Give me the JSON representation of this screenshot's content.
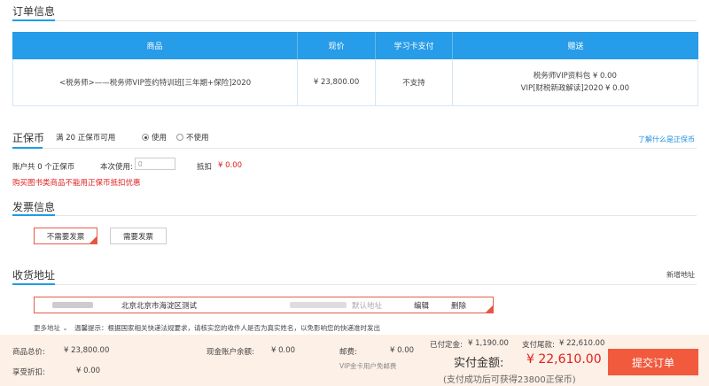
{
  "order": {
    "title": "订单信息",
    "headers": [
      "商品",
      "现价",
      "学习卡支付",
      "赠送"
    ],
    "item": {
      "name": "<税务师>——税务师VIP签约特训班[三年期+保险]2020",
      "price": "¥ 23,800.00",
      "card_pay": "不支持",
      "gifts": [
        "税务师VIP资料包 ¥ 0.00",
        "VIP[财税新政解读]2020 ¥ 0.00"
      ]
    }
  },
  "coin": {
    "title": "正保币",
    "available": "满 20 正保币可用",
    "use_label": "使用",
    "nouse_label": "不使用",
    "learn_more": "了解什么是正保币",
    "account": "账户共 0 个正保币",
    "use_now_label": "本次使用:",
    "use_now_value": "0",
    "deduct_label": "抵扣",
    "deduct_value": "¥ 0.00",
    "warning": "购买图书类商品不能用正保币抵扣优惠"
  },
  "invoice": {
    "title": "发票信息",
    "no_invoice": "不需要发票",
    "need_invoice": "需要发票"
  },
  "address": {
    "title": "收货地址",
    "add_new": "新增地址",
    "location": "北京北京市海淀区测试",
    "default_label": "默认地址",
    "edit": "编辑",
    "delete": "删除",
    "more": "更多地址",
    "tip": "温馨提示：根据国家相关快递法规要求，请核实您的收件人是否为真实姓名，以免影响您的快递准时发出"
  },
  "footer": {
    "total_label": "商品总价:",
    "total_value": "¥ 23,800.00",
    "discount_label": "享受折扣:",
    "discount_value": "¥ 0.00",
    "balance_label": "现金账户余额:",
    "balance_value": "¥ 0.00",
    "shipping_label": "邮费:",
    "shipping_value": "¥ 0.00",
    "vip_note": "VIP金卡用户免邮费",
    "deposit_label": "已付定金:",
    "deposit_value": "¥ 1,190.00",
    "balance_pay_label": "支付尾款:",
    "balance_pay_value": "¥ 22,610.00",
    "pay_label": "实付金额:",
    "pay_value": "¥ 22,610.00",
    "pay_note": "(支付成功后可获得23800正保币)",
    "submit": "提交订单"
  }
}
